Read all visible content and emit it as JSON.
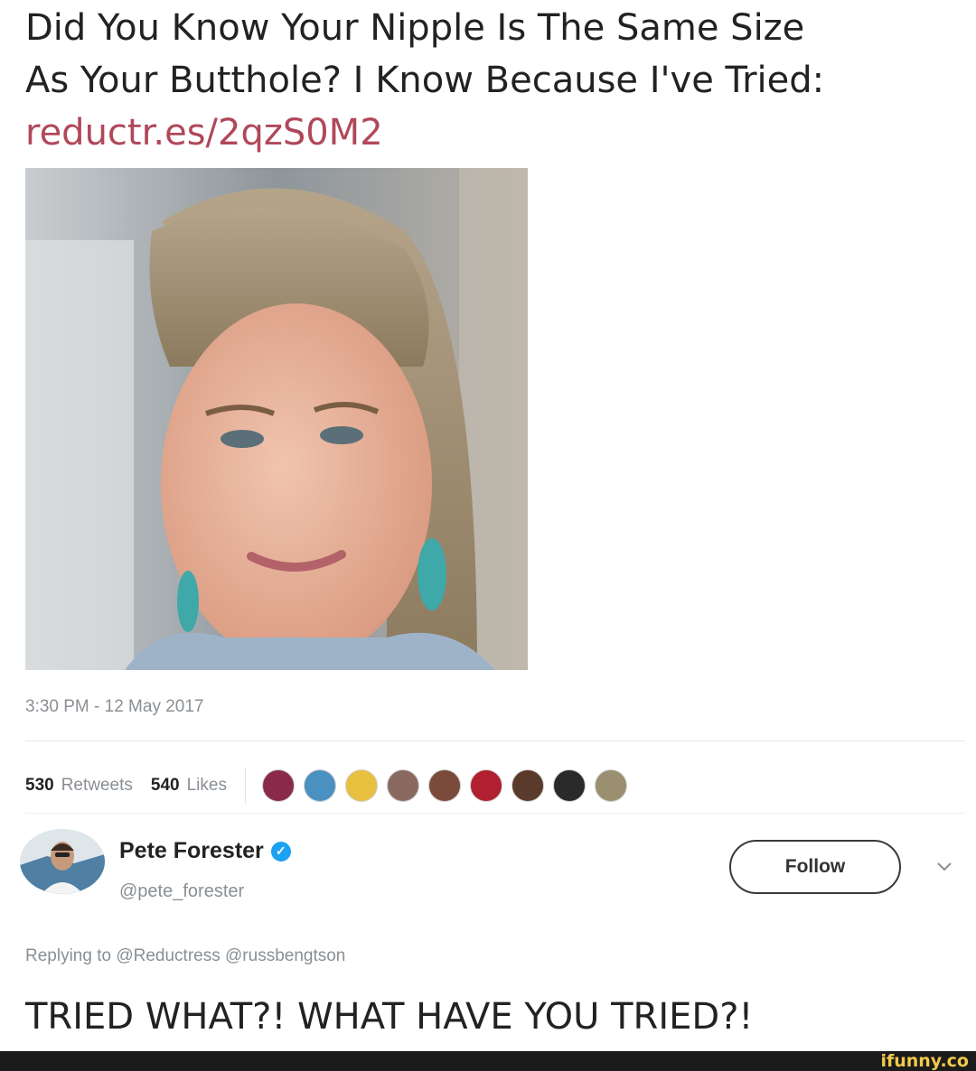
{
  "tweet": {
    "text_line1": "Did You Know Your Nipple Is The Same Size",
    "text_line2": "As Your Butthole? I Know Because I've Tried:",
    "link": "reductr.es/2qzS0M2",
    "timestamp": "3:30 PM - 12 May 2017",
    "retweets_count": "530",
    "retweets_label": "Retweets",
    "likes_count": "540",
    "likes_label": "Likes",
    "liker_avatar_colors": [
      "#8a2a4a",
      "#4a90c0",
      "#e8c040",
      "#8a6a60",
      "#7a4a3a",
      "#b02030",
      "#5a3a2a",
      "#2a2a2a",
      "#9a9070"
    ]
  },
  "reply": {
    "name": "Pete Forester",
    "handle": "@pete_forester",
    "follow_label": "Follow",
    "replying_prefix": "Replying to",
    "mention1": "@Reductress",
    "mention2": "@russbengtson",
    "text": "TRIED WHAT?! WHAT HAVE YOU TRIED?!"
  },
  "watermark": "ifunny.co",
  "colors": {
    "link": "#b0485a",
    "verified": "#1da1f2",
    "watermark": "#f2c94c"
  }
}
